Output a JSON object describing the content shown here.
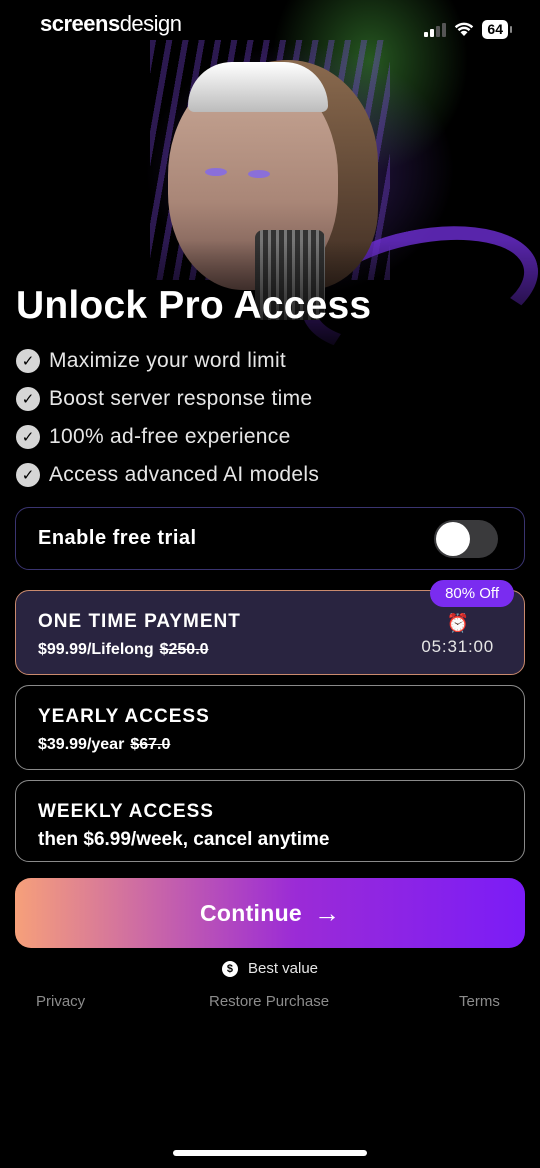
{
  "status_bar": {
    "brand": "screens",
    "brand_suffix": "design",
    "battery": "64"
  },
  "title": "Unlock Pro Access",
  "features": [
    "Maximize your word limit",
    "Boost server response time",
    "100% ad-free experience",
    "Access advanced AI models"
  ],
  "trial": {
    "label": "Enable free trial",
    "enabled": false
  },
  "plans": [
    {
      "name": "ONE TIME PAYMENT",
      "price": "$99.99/Lifelong",
      "old_price": "$250.0",
      "badge": "80% Off",
      "timer": "05:31:00",
      "selected": true
    },
    {
      "name": "YEARLY ACCESS",
      "price": "$39.99/year",
      "old_price": "$67.0",
      "selected": false
    },
    {
      "name": "WEEKLY ACCESS",
      "price": "then $6.99/week, cancel anytime",
      "selected": false
    }
  ],
  "cta": {
    "label": "Continue",
    "arrow": "→"
  },
  "best_value": "Best value",
  "footer": {
    "privacy": "Privacy",
    "restore": "Restore Purchase",
    "terms": "Terms"
  },
  "icons": {
    "check": "check-circle-icon",
    "alarm": "alarm-clock-icon",
    "dollar": "dollar-circle-icon",
    "arrow": "arrow-right-icon"
  },
  "colors": {
    "accent": "#7a2cf0",
    "cta_start": "#f6a07a",
    "cta_end": "#7b1cf7",
    "selected_border": "#c98a6e"
  }
}
